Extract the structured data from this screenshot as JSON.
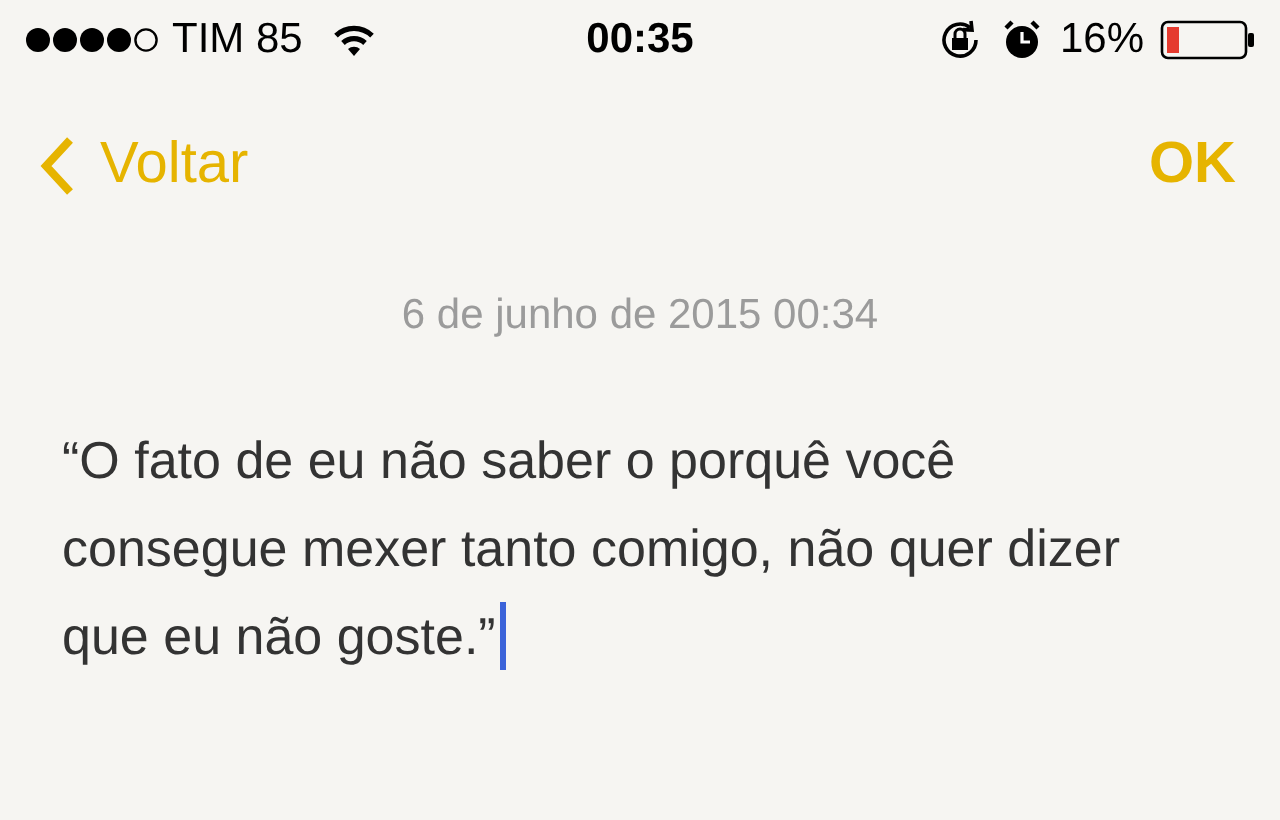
{
  "status_bar": {
    "carrier": "TIM 85",
    "time": "00:35",
    "battery": "16%"
  },
  "nav": {
    "back": "Voltar",
    "done": "OK"
  },
  "note": {
    "date": "6 de junho de 2015 00:34",
    "text": "“O fato de eu não saber o porquê você consegue mexer tanto comigo, não quer dizer que eu não goste.”",
    "cursor": true
  }
}
